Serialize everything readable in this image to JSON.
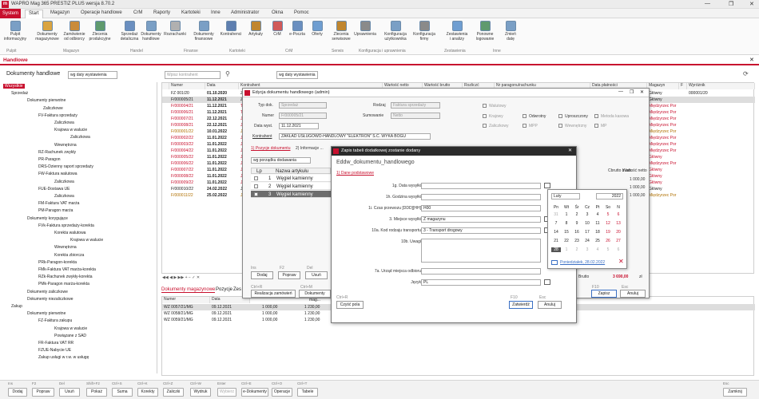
{
  "app": {
    "title": "WAPRO Mag 365 PRESTIZ PLUS  wersja 8.70.2",
    "logo": "m",
    "window_controls": [
      "—",
      "❐",
      "✕"
    ]
  },
  "menu": {
    "system": "System",
    "tabs": [
      "Start",
      "Magazyn",
      "Operacje handlowe",
      "CrM",
      "Raporty",
      "Kartoteki",
      "Inne",
      "Administrator",
      "Okna",
      "Pomoc"
    ]
  },
  "ribbon": {
    "buttons": [
      {
        "label": "Pulpit\ninformacyjny"
      },
      {
        "label": "Dokumenty\nmagazynowe"
      },
      {
        "label": "Zamówienie\nod odbiorcy"
      },
      {
        "label": "Zlecenia\nprodukcyjne"
      },
      {
        "label": "Sprzedaż\ndetaliczna"
      },
      {
        "label": "Dokumenty\nhandlowe"
      },
      {
        "label": "Rozrachunki"
      },
      {
        "label": "Dokumenty\nfinansowe"
      },
      {
        "label": "Kontrahenci"
      },
      {
        "label": "Artykuły"
      },
      {
        "label": "CrM"
      },
      {
        "label": "e-Poczta"
      },
      {
        "label": "Oferty"
      },
      {
        "label": "Zlecenia\nserwisowe"
      },
      {
        "label": "Uprawnienia"
      },
      {
        "label": "Konfiguracja\nużytkownika"
      },
      {
        "label": "Konfiguracja\nfirmy"
      },
      {
        "label": "Zestawienia\ni analizy"
      },
      {
        "label": "Ponowne\nlogowanie"
      },
      {
        "label": "Zmień\ndatę"
      }
    ],
    "groups": [
      "Pulpit",
      "Magazyn",
      "Handel",
      "Finanse",
      "Kartoteki",
      "CrM",
      "Serwis",
      "Konfiguracja i uprawnienia",
      "Zestawienia",
      "Inne"
    ]
  },
  "module_tab": "Handlowe",
  "toolbar": {
    "title": "Dokumenty handlowe",
    "sort1": "wg daty wystawienia",
    "search_placeholder": "Wpisz kontrahent",
    "sort2": "wg daty wystawienia"
  },
  "tree": [
    {
      "label": "Wszystkie",
      "selected": true
    },
    {
      "label": "Sprzedaż"
    },
    {
      "label": "Dokumenty pierwotne"
    },
    {
      "label": "Zaliczkowe"
    },
    {
      "label": "FV-Faktura sprzedaży"
    },
    {
      "label": "Zaliczkowa"
    },
    {
      "label": "Krajowa w walucie"
    },
    {
      "label": "Zaliczkowa"
    },
    {
      "label": "Wewnętrzna"
    },
    {
      "label": "RZ-Rachunek zwykły"
    },
    {
      "label": "PR-Paragon"
    },
    {
      "label": "DRS-Dzienny raport sprzedaży"
    },
    {
      "label": "FW-Faktura walutowa"
    },
    {
      "label": "Zaliczkowa"
    },
    {
      "label": "FUE-Dostawa UE"
    },
    {
      "label": "Zaliczkowa"
    },
    {
      "label": "FM-Faktura VAT marża"
    },
    {
      "label": "PM-Paragon marża"
    },
    {
      "label": "Dokumenty korygujące"
    },
    {
      "label": "FVk-Faktura sprzedaży-korekta"
    },
    {
      "label": "Korekta walutowa"
    },
    {
      "label": "Krajowa w walucie"
    },
    {
      "label": "Wewnętrzna"
    },
    {
      "label": "Korekta zbiorcza"
    },
    {
      "label": "PRk-Paragon-korekta"
    },
    {
      "label": "FMk-Faktura VAT marża-korekta"
    },
    {
      "label": "RZk-Rachunek zwykły-korekta"
    },
    {
      "label": "PMk-Paragon marża-korekta"
    },
    {
      "label": "Dokumenty zaliczkowe"
    },
    {
      "label": "Dokumenty niezaliczkowe"
    },
    {
      "label": "Zakup"
    },
    {
      "label": "Dokumenty pierwotne"
    },
    {
      "label": "FZ-Faktura zakupu"
    },
    {
      "label": "Krajowa w walucie"
    },
    {
      "label": "Powiązane z SAD"
    },
    {
      "label": "FR-Faktura VAT RR"
    },
    {
      "label": "FZUE-Nabycie UE"
    },
    {
      "label": "Zakup usługi w r.w. w usługę"
    }
  ],
  "grid": {
    "headers": [
      "Numer",
      "Data",
      "Kontrahent",
      "Wartość netto",
      "Wartość brutto",
      "Rozliczć",
      "Nr paragonu/rachunku",
      "Data płatności",
      "Magazyn",
      "F",
      "Wyróżnik"
    ],
    "rows": [
      {
        "numer": "FZ 001/20",
        "data": "01.10.2020",
        "kontr": "ZA",
        "mag": "Główny",
        "wyr": "000001/20",
        "style": ""
      },
      {
        "numer": "F/000005/21",
        "data": "11.12.2021",
        "kontr": "ZA",
        "mag": "Główny",
        "wyr": "",
        "style": "sel"
      },
      {
        "numer": "F/000004/21",
        "data": "11.12.2021",
        "kontr": "Te",
        "mag": "Międzyrzec Por",
        "wyr": "",
        "style": "red"
      },
      {
        "numer": "F/000006/21",
        "data": "11.12.2021",
        "kontr": "Te",
        "mag": "Międzyrzec Por",
        "wyr": "",
        "style": "red"
      },
      {
        "numer": "F/000007/21",
        "data": "22.12.2021",
        "kontr": "Ja",
        "mag": "Międzyrzec Por",
        "wyr": "",
        "style": "red"
      },
      {
        "numer": "F/000008/21",
        "data": "22.12.2021",
        "kontr": "Ja",
        "mag": "Międzyrzec Por",
        "wyr": "",
        "style": "red"
      },
      {
        "numer": "F/000001/22",
        "data": "10.01.2022",
        "kontr": "Ja",
        "mag": "Międzyrzec Por",
        "wyr": "",
        "style": "orange"
      },
      {
        "numer": "F/000002/22",
        "data": "11.01.2022",
        "kontr": "Ja",
        "mag": "Międzyrzec Por",
        "wyr": "",
        "style": "red"
      },
      {
        "numer": "F/000003/22",
        "data": "11.01.2022",
        "kontr": "Ja",
        "mag": "Międzyrzec Por",
        "wyr": "",
        "style": "red"
      },
      {
        "numer": "F/000004/22",
        "data": "11.01.2022",
        "kontr": "Ja",
        "mag": "Międzyrzec Por",
        "wyr": "",
        "style": "red"
      },
      {
        "numer": "F/000005/22",
        "data": "11.01.2022",
        "kontr": "Ja",
        "mag": "Główny",
        "wyr": "",
        "style": "red"
      },
      {
        "numer": "F/000006/22",
        "data": "11.01.2022",
        "kontr": "Ja",
        "mag": "Międzyrzec Por",
        "wyr": "",
        "style": "red"
      },
      {
        "numer": "F/000007/22",
        "data": "11.01.2022",
        "kontr": "Ja",
        "mag": "Główny",
        "wyr": "",
        "style": "red"
      },
      {
        "numer": "F/000008/22",
        "data": "11.01.2022",
        "kontr": "Ja",
        "mag": "Główny",
        "wyr": "",
        "style": "red"
      },
      {
        "numer": "F/000009/22",
        "data": "11.01.2022",
        "kontr": "Ja",
        "mag": "Główny",
        "wyr": "",
        "style": "red"
      },
      {
        "numer": "F/000010/22",
        "data": "24.02.2022",
        "kontr": "Ja",
        "mag": "Główny",
        "wyr": "",
        "style": ""
      },
      {
        "numer": "F/000011/22",
        "data": "25.02.2022",
        "kontr": "Ja",
        "mag": "Międzyrzec Por",
        "wyr": "",
        "style": "orange"
      }
    ]
  },
  "subtabs": [
    "Dokumenty magazynowe",
    "Pozycje",
    "Zes"
  ],
  "subgrid": {
    "headers": [
      "Numer",
      "Data"
    ],
    "rows": [
      {
        "numer": "WZ 0057/21/MG",
        "data": "09.12.2021",
        "v1": "1 000,00",
        "v2": "1 230,00",
        "mag": "Główny"
      },
      {
        "numer": "WZ 0058/21/MG",
        "data": "09.12.2021",
        "v1": "1 000,00",
        "v2": "1 230,00",
        "mag": "Główny"
      },
      {
        "numer": "WZ 0059/21/MG",
        "data": "09.12.2021",
        "v1": "1 000,00",
        "v2": "1 230,00",
        "mag": "Główny"
      }
    ]
  },
  "bottombar": {
    "buttons": [
      {
        "key": "Ins",
        "label": "Dodaj"
      },
      {
        "key": "F2",
        "label": "Popraw"
      },
      {
        "key": "Del",
        "label": "Usuń"
      },
      {
        "key": "Shift+F2",
        "label": "Pokaż"
      },
      {
        "key": "Ctrl+S",
        "label": "Suma"
      },
      {
        "key": "Ctrl+K",
        "label": "Korekty"
      },
      {
        "key": "Ctrl+Z",
        "label": "Zaliczki"
      },
      {
        "key": "Ctrl+W",
        "label": "Wydruk"
      },
      {
        "key": "Enter",
        "label": "Wybierz"
      },
      {
        "key": "Ctrl+E",
        "label": "e-Dokumenty"
      },
      {
        "key": "Ctrl+O",
        "label": "Operacje"
      },
      {
        "key": "Ctrl+T",
        "label": "Tabele"
      },
      {
        "key": "Esc",
        "label": "Zamknij"
      }
    ]
  },
  "dialog1": {
    "title": "Edycja dokumentu handlowego (admin)",
    "typ_dok_label": "Typ dok.",
    "typ_dok": "Sprzedaż",
    "numer_label": "Numer",
    "numer": "F/000005/21",
    "data_label": "Data wyst.",
    "data": "11.12.2021",
    "kontr_label": "Kontrahent",
    "kontr": "ZAKŁAD USŁUGOWO-HANDLOWY \"ELEKTRON\" S.C. WYKA BOGU",
    "rodzaj_label": "Rodzaj",
    "rodzaj": "Faktura sprzedaży",
    "sumowanie_label": "Sumowanie",
    "sumowanie": "Netto",
    "checks": [
      "Walutowy",
      "Krajowy",
      "Zaliczkowy",
      "Odwrotny",
      "MPP",
      "Uproszczony",
      "Wewnętrzny",
      "Metoda kasowa",
      "MP"
    ],
    "tabs": [
      "1) Pozycje dokumentu",
      "2) Informacje ...",
      "3) Dane dodatkowe"
    ],
    "sort": "wg porządku dodawania",
    "pos_headers": [
      "Lp",
      "Nazwa artykułu"
    ],
    "positions": [
      {
        "lp": "1",
        "name": "Węgiel kamienny"
      },
      {
        "lp": "2",
        "name": "Węgiel kamienny"
      },
      {
        "lp": "3",
        "name": "Węgiel kamienny"
      }
    ],
    "netto_label": "Cbrutto z rab.",
    "wart_label": "Wartość netto",
    "netto_vals": [
      "1 000,00",
      "1 000,00",
      "1 000,00"
    ],
    "zl": "zł",
    "brutto_label": "Brutto",
    "brutto": "3 690,00",
    "btn_dodaj": "Dodaj",
    "btn_popraw": "Popraw",
    "btn_usun": "Usuń",
    "btn_realizacja": "Realizacja zamówień",
    "btn_dokmag": "Dokumenty mag...",
    "btn_zapisz": "Zapisz",
    "btn_anuluj": "Anuluj",
    "key_ins": "Ins",
    "key_f2": "F2",
    "key_del": "Del",
    "key_ctrlr": "Ctrl+R",
    "key_ctrlm": "Ctrl+M",
    "key_f10": "F10",
    "key_esc": "Esc"
  },
  "dialog2": {
    "title": "Zapis tabeli dodatkowej zostanie dodany",
    "header": "Eddw_dokumentu_handlowego",
    "tab": "1) Dane podstawowe",
    "fields": [
      {
        "label": "1g. Data wysyłki",
        "value": ""
      },
      {
        "label": "1h. Godzina wysyłki",
        "value": ""
      },
      {
        "label": "1i. Czas przewozu [DDD][HH]",
        "value": "H00"
      },
      {
        "label": "3. Miejsce wysyłki",
        "value": "Z magazynu"
      },
      {
        "label": "10a. Kod rodzaju transportu",
        "value": "3 - Transport drogowy"
      },
      {
        "label": "10b. Uwagi",
        "value": ""
      },
      {
        "label": "7a. Urząd miejsca odbioru",
        "value": ""
      },
      {
        "label": "Język",
        "value": "PL"
      }
    ],
    "btn_czysc": "Czyść pola",
    "btn_zatwierdz": "Zatwierdź",
    "btn_anuluj": "Anuluj",
    "key_ctrlr": "Ctrl+R",
    "key_f10": "F10",
    "key_esc": "Esc"
  },
  "calendar": {
    "month": "Luty",
    "year": "2022",
    "weekdays": [
      "Pn",
      "Wt",
      "Śr",
      "Cz",
      "Pt",
      "So",
      "N"
    ],
    "weeks": [
      [
        "31",
        "1",
        "2",
        "3",
        "4",
        "5",
        "6"
      ],
      [
        "7",
        "8",
        "9",
        "10",
        "11",
        "12",
        "13"
      ],
      [
        "14",
        "15",
        "16",
        "17",
        "18",
        "19",
        "20"
      ],
      [
        "21",
        "22",
        "23",
        "24",
        "25",
        "26",
        "27"
      ],
      [
        "28",
        "1",
        "2",
        "3",
        "4",
        "5",
        "6"
      ]
    ],
    "today_label": "Poniedziałek, 28.02.2022",
    "accent": "#c8102e"
  }
}
